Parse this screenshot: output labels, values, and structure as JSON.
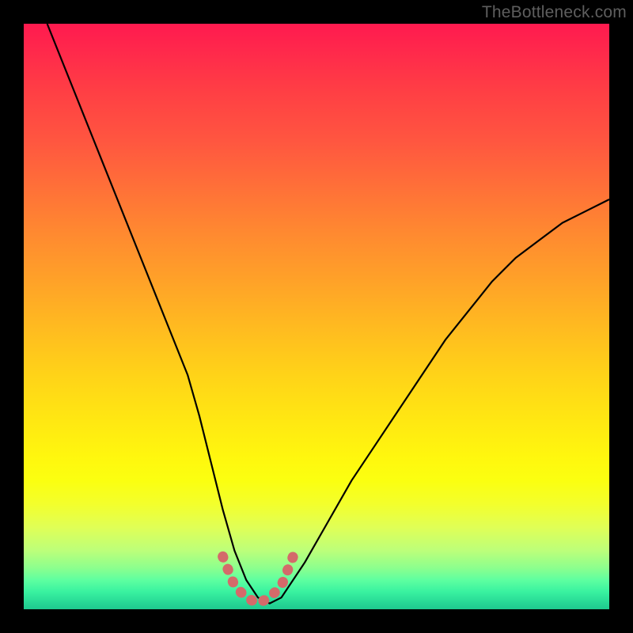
{
  "watermark": {
    "text": "TheBottleneck.com"
  },
  "colors": {
    "curve_stroke": "#000000",
    "highlight_stroke": "#d46a6a",
    "background_black": "#000000"
  },
  "chart_data": {
    "type": "line",
    "title": "",
    "xlabel": "",
    "ylabel": "",
    "xlim": [
      0,
      100
    ],
    "ylim": [
      0,
      100
    ],
    "grid": false,
    "legend": false,
    "series": [
      {
        "name": "bottleneck-curve",
        "x": [
          4,
          8,
          12,
          16,
          20,
          24,
          28,
          30,
          32,
          34,
          36,
          38,
          40,
          42,
          44,
          48,
          52,
          56,
          60,
          64,
          68,
          72,
          76,
          80,
          84,
          88,
          92,
          96,
          100
        ],
        "y": [
          100,
          90,
          80,
          70,
          60,
          50,
          40,
          33,
          25,
          17,
          10,
          5,
          2,
          1,
          2,
          8,
          15,
          22,
          28,
          34,
          40,
          46,
          51,
          56,
          60,
          63,
          66,
          68,
          70
        ]
      },
      {
        "name": "optimal-range",
        "x": [
          34,
          36,
          38,
          40,
          42,
          44,
          46
        ],
        "y": [
          9,
          4,
          2,
          1,
          2,
          4,
          9
        ]
      }
    ],
    "annotations": []
  }
}
